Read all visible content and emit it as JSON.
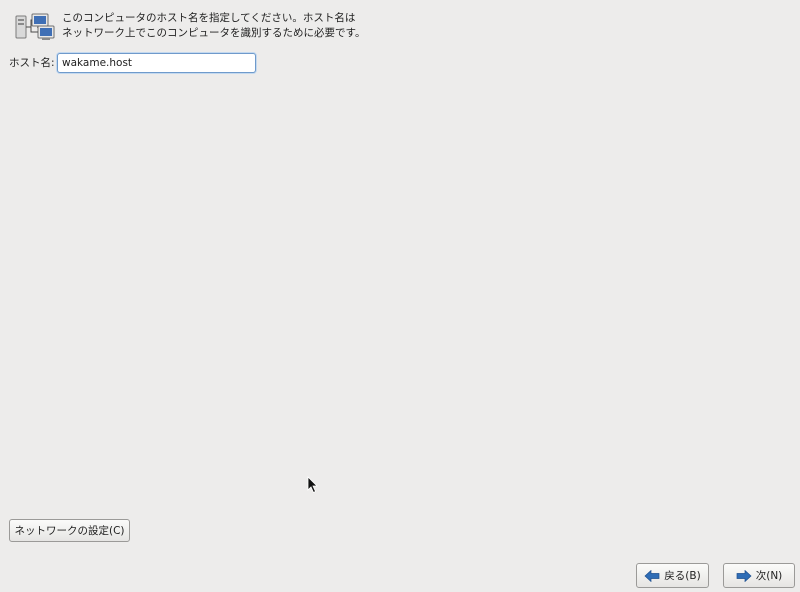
{
  "header": {
    "icon": "network-computers-icon",
    "description_line1": "このコンピュータのホスト名を指定してください。ホスト名は",
    "description_line2": "ネットワーク上でこのコンピュータを識別するために必要です。"
  },
  "hostname": {
    "label": "ホスト名:",
    "value": "wakame.host"
  },
  "buttons": {
    "network_config": "ネットワークの設定(C)",
    "back": "戻る(B)",
    "next": "次(N)"
  },
  "icons": {
    "back": "arrow-left-icon",
    "next": "arrow-right-icon",
    "cursor": "mouse-pointer-icon"
  },
  "colors": {
    "background": "#edeceb",
    "arrow": "#2f6db6",
    "input_border": "#6f9acb"
  }
}
